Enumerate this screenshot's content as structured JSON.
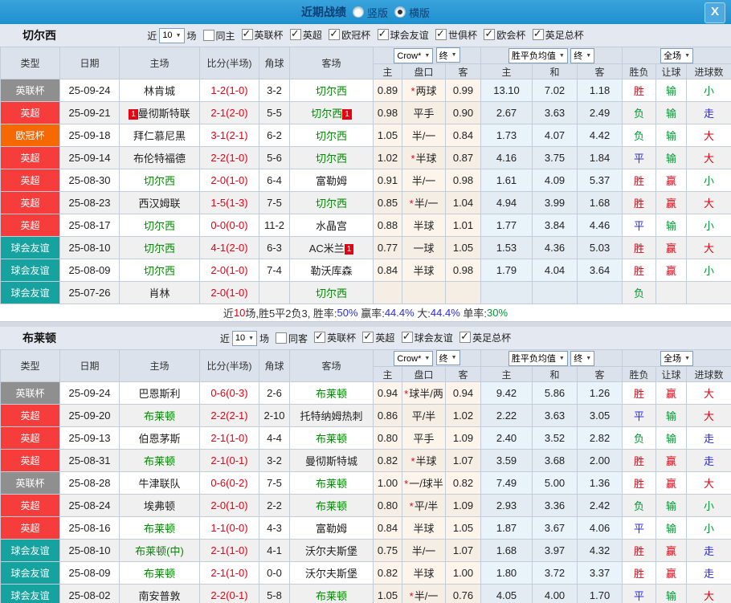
{
  "titlebar": {
    "title": "近期战绩",
    "radios": [
      {
        "label": "竖版",
        "selected": false
      },
      {
        "label": "横版",
        "selected": true
      }
    ],
    "close_icon": "X"
  },
  "table_header": {
    "cols": [
      "类型",
      "日期",
      "主场",
      "比分(半场)",
      "角球",
      "客场"
    ],
    "odds_select": "Crow*",
    "final_select": "终",
    "avg_select": "胜平负均值",
    "full_select": "全场",
    "sub": [
      "主",
      "盘口",
      "客",
      "主",
      "和",
      "客",
      "胜负",
      "让球",
      "进球数"
    ]
  },
  "type_colors": {
    "英联杯": "#8f8f8f",
    "英超": "#f73c3c",
    "欧冠杯": "#f66800",
    "球会友谊": "#16a3a0"
  },
  "value_colors": {
    "胜": "#e60012",
    "赢": "#e60012",
    "大": "#e60012",
    "负": "#009933",
    "输": "#009933",
    "小": "#009933",
    "平": "#2d2dd9",
    "走": "#2d2dd9"
  },
  "accent_colors": {
    "titlebar_blue": "#2397d5",
    "score_red": "#e60012",
    "focal_green": "#008800",
    "odds_bg": "#fdf5eb",
    "avg_bg": "#e9f3fa"
  },
  "sections": [
    {
      "team": "切尔西",
      "filter": {
        "near_label": "近",
        "count": "10",
        "matches_label": "场",
        "same_venue": {
          "label": "同主",
          "checked": false
        },
        "leagues": [
          {
            "label": "英联杯",
            "checked": true
          },
          {
            "label": "英超",
            "checked": true
          },
          {
            "label": "欧冠杯",
            "checked": true
          },
          {
            "label": "球会友谊",
            "checked": true
          },
          {
            "label": "世俱杯",
            "checked": true
          },
          {
            "label": "欧会杯",
            "checked": true
          },
          {
            "label": "英足总杯",
            "checked": true
          }
        ]
      },
      "rows": [
        {
          "type": "英联杯",
          "date": "25-09-24",
          "home": {
            "name": "林肯城",
            "focal": false,
            "card": null
          },
          "score": "1-2(1-0)",
          "corner": "3-2",
          "away": {
            "name": "切尔西",
            "focal": true,
            "card": null
          },
          "odds": {
            "home": "0.89",
            "line": "两球",
            "line_star": true,
            "away": "0.99"
          },
          "avg": {
            "home": "13.10",
            "draw": "7.02",
            "away": "1.18"
          },
          "outcome": "胜",
          "handicap": "输",
          "goals": "小"
        },
        {
          "type": "英超",
          "date": "25-09-21",
          "home": {
            "name": "曼彻斯特联",
            "focal": false,
            "card": "1"
          },
          "score": "2-1(2-0)",
          "corner": "5-5",
          "away": {
            "name": "切尔西",
            "focal": true,
            "card": "1"
          },
          "odds": {
            "home": "0.98",
            "line": "平手",
            "line_star": false,
            "away": "0.90"
          },
          "avg": {
            "home": "2.67",
            "draw": "3.63",
            "away": "2.49"
          },
          "outcome": "负",
          "handicap": "输",
          "goals": "走"
        },
        {
          "type": "欧冠杯",
          "date": "25-09-18",
          "home": {
            "name": "拜仁慕尼黑",
            "focal": false,
            "card": null
          },
          "score": "3-1(2-1)",
          "corner": "6-2",
          "away": {
            "name": "切尔西",
            "focal": true,
            "card": null
          },
          "odds": {
            "home": "1.05",
            "line": "半/一",
            "line_star": false,
            "away": "0.84"
          },
          "avg": {
            "home": "1.73",
            "draw": "4.07",
            "away": "4.42"
          },
          "outcome": "负",
          "handicap": "输",
          "goals": "大"
        },
        {
          "type": "英超",
          "date": "25-09-14",
          "home": {
            "name": "布伦特福德",
            "focal": false,
            "card": null
          },
          "score": "2-2(1-0)",
          "corner": "5-6",
          "away": {
            "name": "切尔西",
            "focal": true,
            "card": null
          },
          "odds": {
            "home": "1.02",
            "line": "半球",
            "line_star": true,
            "away": "0.87"
          },
          "avg": {
            "home": "4.16",
            "draw": "3.75",
            "away": "1.84"
          },
          "outcome": "平",
          "handicap": "输",
          "goals": "大"
        },
        {
          "type": "英超",
          "date": "25-08-30",
          "home": {
            "name": "切尔西",
            "focal": true,
            "card": null
          },
          "score": "2-0(1-0)",
          "corner": "6-4",
          "away": {
            "name": "富勒姆",
            "focal": false,
            "card": null
          },
          "odds": {
            "home": "0.91",
            "line": "半/一",
            "line_star": false,
            "away": "0.98"
          },
          "avg": {
            "home": "1.61",
            "draw": "4.09",
            "away": "5.37"
          },
          "outcome": "胜",
          "handicap": "赢",
          "goals": "小"
        },
        {
          "type": "英超",
          "date": "25-08-23",
          "home": {
            "name": "西汉姆联",
            "focal": false,
            "card": null
          },
          "score": "1-5(1-3)",
          "corner": "7-5",
          "away": {
            "name": "切尔西",
            "focal": true,
            "card": null
          },
          "odds": {
            "home": "0.85",
            "line": "半/一",
            "line_star": true,
            "away": "1.04"
          },
          "avg": {
            "home": "4.94",
            "draw": "3.99",
            "away": "1.68"
          },
          "outcome": "胜",
          "handicap": "赢",
          "goals": "大"
        },
        {
          "type": "英超",
          "date": "25-08-17",
          "home": {
            "name": "切尔西",
            "focal": true,
            "card": null
          },
          "score": "0-0(0-0)",
          "corner": "11-2",
          "away": {
            "name": "水晶宫",
            "focal": false,
            "card": null
          },
          "odds": {
            "home": "0.88",
            "line": "半球",
            "line_star": false,
            "away": "1.01"
          },
          "avg": {
            "home": "1.77",
            "draw": "3.84",
            "away": "4.46"
          },
          "outcome": "平",
          "handicap": "输",
          "goals": "小"
        },
        {
          "type": "球会友谊",
          "date": "25-08-10",
          "home": {
            "name": "切尔西",
            "focal": true,
            "card": null
          },
          "score": "4-1(2-0)",
          "corner": "6-3",
          "away": {
            "name": "AC米兰",
            "focal": false,
            "card": "1"
          },
          "odds": {
            "home": "0.77",
            "line": "一球",
            "line_star": false,
            "away": "1.05"
          },
          "avg": {
            "home": "1.53",
            "draw": "4.36",
            "away": "5.03"
          },
          "outcome": "胜",
          "handicap": "赢",
          "goals": "大"
        },
        {
          "type": "球会友谊",
          "date": "25-08-09",
          "home": {
            "name": "切尔西",
            "focal": true,
            "card": null
          },
          "score": "2-0(1-0)",
          "corner": "7-4",
          "away": {
            "name": "勒沃库森",
            "focal": false,
            "card": null
          },
          "odds": {
            "home": "0.84",
            "line": "半球",
            "line_star": false,
            "away": "0.98"
          },
          "avg": {
            "home": "1.79",
            "draw": "4.04",
            "away": "3.64"
          },
          "outcome": "胜",
          "handicap": "赢",
          "goals": "小"
        },
        {
          "type": "球会友谊",
          "date": "25-07-26",
          "home": {
            "name": "肖林",
            "focal": false,
            "card": null
          },
          "score": "2-0(1-0)",
          "corner": "",
          "away": {
            "name": "切尔西",
            "focal": true,
            "card": null
          },
          "odds": {
            "home": "",
            "line": "",
            "line_star": false,
            "away": ""
          },
          "avg": {
            "home": "",
            "draw": "",
            "away": ""
          },
          "outcome": "负",
          "handicap": "",
          "goals": ""
        }
      ],
      "summary": [
        {
          "text": "近",
          "color": "#333333"
        },
        {
          "text": "10",
          "color": "#e60012"
        },
        {
          "text": "场,胜5平2负3, 胜率:",
          "color": "#333333"
        },
        {
          "text": "50%",
          "color": "#2d2dd9"
        },
        {
          "text": " 赢率:",
          "color": "#333333"
        },
        {
          "text": "44.4%",
          "color": "#2d2dd9"
        },
        {
          "text": " 大:",
          "color": "#333333"
        },
        {
          "text": "44.4%",
          "color": "#2d2dd9"
        },
        {
          "text": " 单率:",
          "color": "#333333"
        },
        {
          "text": "30%",
          "color": "#009933"
        }
      ]
    },
    {
      "team": "布莱顿",
      "filter": {
        "near_label": "近",
        "count": "10",
        "matches_label": "场",
        "same_venue": {
          "label": "同客",
          "checked": false
        },
        "leagues": [
          {
            "label": "英联杯",
            "checked": true
          },
          {
            "label": "英超",
            "checked": true
          },
          {
            "label": "球会友谊",
            "checked": true
          },
          {
            "label": "英足总杯",
            "checked": true
          }
        ]
      },
      "rows": [
        {
          "type": "英联杯",
          "date": "25-09-24",
          "home": {
            "name": "巴恩斯利",
            "focal": false,
            "card": null
          },
          "score": "0-6(0-3)",
          "corner": "2-6",
          "away": {
            "name": "布莱顿",
            "focal": true,
            "card": null
          },
          "odds": {
            "home": "0.94",
            "line": "球半/两",
            "line_star": true,
            "away": "0.94"
          },
          "avg": {
            "home": "9.42",
            "draw": "5.86",
            "away": "1.26"
          },
          "outcome": "胜",
          "handicap": "赢",
          "goals": "大"
        },
        {
          "type": "英超",
          "date": "25-09-20",
          "home": {
            "name": "布莱顿",
            "focal": true,
            "card": null
          },
          "score": "2-2(2-1)",
          "corner": "2-10",
          "away": {
            "name": "托特纳姆热刺",
            "focal": false,
            "card": null
          },
          "odds": {
            "home": "0.86",
            "line": "平/半",
            "line_star": false,
            "away": "1.02"
          },
          "avg": {
            "home": "2.22",
            "draw": "3.63",
            "away": "3.05"
          },
          "outcome": "平",
          "handicap": "输",
          "goals": "大"
        },
        {
          "type": "英超",
          "date": "25-09-13",
          "home": {
            "name": "伯恩茅斯",
            "focal": false,
            "card": null
          },
          "score": "2-1(1-0)",
          "corner": "4-4",
          "away": {
            "name": "布莱顿",
            "focal": true,
            "card": null
          },
          "odds": {
            "home": "0.80",
            "line": "平手",
            "line_star": false,
            "away": "1.09"
          },
          "avg": {
            "home": "2.40",
            "draw": "3.52",
            "away": "2.82"
          },
          "outcome": "负",
          "handicap": "输",
          "goals": "走"
        },
        {
          "type": "英超",
          "date": "25-08-31",
          "home": {
            "name": "布莱顿",
            "focal": true,
            "card": null
          },
          "score": "2-1(0-1)",
          "corner": "3-2",
          "away": {
            "name": "曼彻斯特城",
            "focal": false,
            "card": null
          },
          "odds": {
            "home": "0.82",
            "line": "半球",
            "line_star": true,
            "away": "1.07"
          },
          "avg": {
            "home": "3.59",
            "draw": "3.68",
            "away": "2.00"
          },
          "outcome": "胜",
          "handicap": "赢",
          "goals": "走"
        },
        {
          "type": "英联杯",
          "date": "25-08-28",
          "home": {
            "name": "牛津联队",
            "focal": false,
            "card": null
          },
          "score": "0-6(0-2)",
          "corner": "7-5",
          "away": {
            "name": "布莱顿",
            "focal": true,
            "card": null
          },
          "odds": {
            "home": "1.00",
            "line": "一/球半",
            "line_star": true,
            "away": "0.82"
          },
          "avg": {
            "home": "7.49",
            "draw": "5.00",
            "away": "1.36"
          },
          "outcome": "胜",
          "handicap": "赢",
          "goals": "大"
        },
        {
          "type": "英超",
          "date": "25-08-24",
          "home": {
            "name": "埃弗顿",
            "focal": false,
            "card": null
          },
          "score": "2-0(1-0)",
          "corner": "2-2",
          "away": {
            "name": "布莱顿",
            "focal": true,
            "card": null
          },
          "odds": {
            "home": "0.80",
            "line": "平/半",
            "line_star": true,
            "away": "1.09"
          },
          "avg": {
            "home": "2.93",
            "draw": "3.36",
            "away": "2.42"
          },
          "outcome": "负",
          "handicap": "输",
          "goals": "小"
        },
        {
          "type": "英超",
          "date": "25-08-16",
          "home": {
            "name": "布莱顿",
            "focal": true,
            "card": null
          },
          "score": "1-1(0-0)",
          "corner": "4-3",
          "away": {
            "name": "富勒姆",
            "focal": false,
            "card": null
          },
          "odds": {
            "home": "0.84",
            "line": "半球",
            "line_star": false,
            "away": "1.05"
          },
          "avg": {
            "home": "1.87",
            "draw": "3.67",
            "away": "4.06"
          },
          "outcome": "平",
          "handicap": "输",
          "goals": "小"
        },
        {
          "type": "球会友谊",
          "date": "25-08-10",
          "home": {
            "name": "布莱顿(中)",
            "focal": true,
            "card": null
          },
          "score": "2-1(1-0)",
          "corner": "4-1",
          "away": {
            "name": "沃尔夫斯堡",
            "focal": false,
            "card": null
          },
          "odds": {
            "home": "0.75",
            "line": "半/一",
            "line_star": false,
            "away": "1.07"
          },
          "avg": {
            "home": "1.68",
            "draw": "3.97",
            "away": "4.32"
          },
          "outcome": "胜",
          "handicap": "赢",
          "goals": "走"
        },
        {
          "type": "球会友谊",
          "date": "25-08-09",
          "home": {
            "name": "布莱顿",
            "focal": true,
            "card": null
          },
          "score": "2-1(1-0)",
          "corner": "0-0",
          "away": {
            "name": "沃尔夫斯堡",
            "focal": false,
            "card": null
          },
          "odds": {
            "home": "0.82",
            "line": "半球",
            "line_star": false,
            "away": "1.00"
          },
          "avg": {
            "home": "1.80",
            "draw": "3.72",
            "away": "3.37"
          },
          "outcome": "胜",
          "handicap": "赢",
          "goals": "走"
        },
        {
          "type": "球会友谊",
          "date": "25-08-02",
          "home": {
            "name": "南安普敦",
            "focal": false,
            "card": null
          },
          "score": "2-2(0-1)",
          "corner": "5-8",
          "away": {
            "name": "布莱顿",
            "focal": true,
            "card": null
          },
          "odds": {
            "home": "1.05",
            "line": "半/一",
            "line_star": true,
            "away": "0.76"
          },
          "avg": {
            "home": "4.05",
            "draw": "4.00",
            "away": "1.70"
          },
          "outcome": "平",
          "handicap": "输",
          "goals": "大"
        }
      ],
      "summary": null
    }
  ]
}
